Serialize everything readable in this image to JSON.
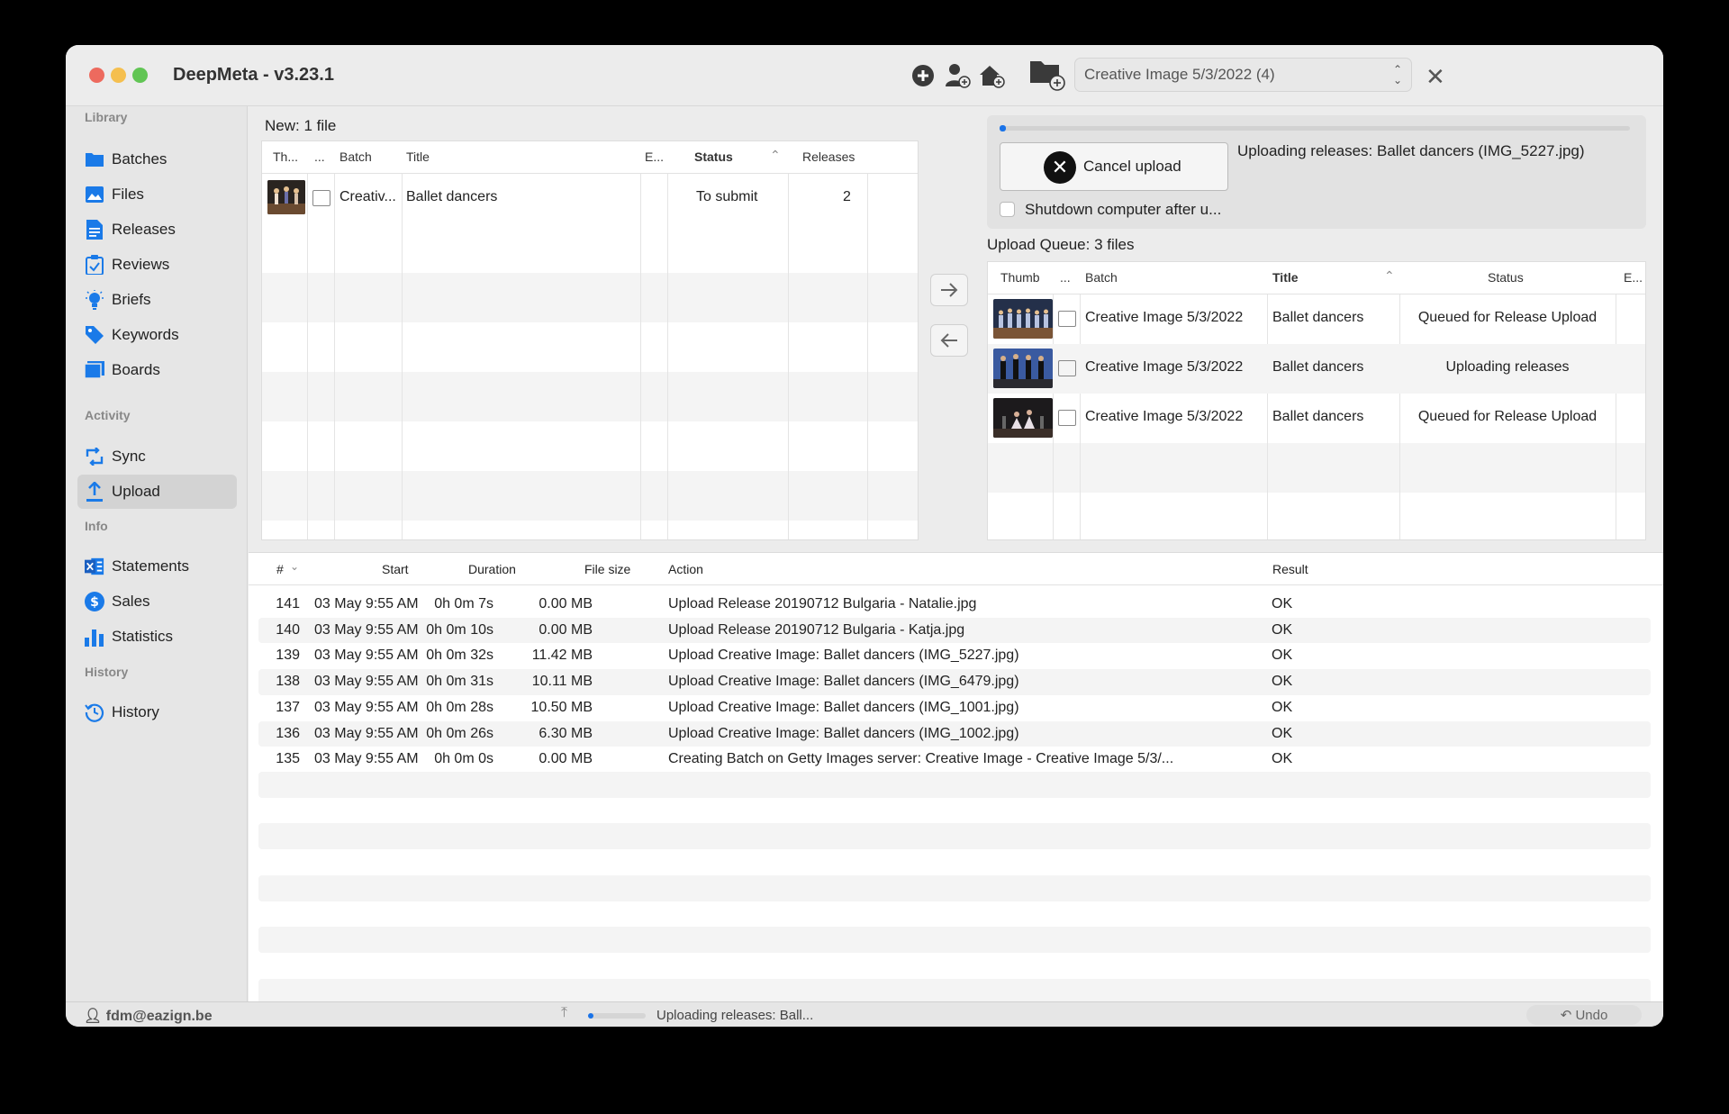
{
  "window": {
    "title": "DeepMeta - v3.23.1",
    "batch_selector": "Creative Image 5/3/2022 (4)"
  },
  "sidebar": {
    "sections": [
      "Library",
      "Activity",
      "Info",
      "History"
    ],
    "library": [
      {
        "label": "Batches",
        "icon": "folder-icon"
      },
      {
        "label": "Files",
        "icon": "image-icon"
      },
      {
        "label": "Releases",
        "icon": "document-icon"
      },
      {
        "label": "Reviews",
        "icon": "clipboard-check-icon"
      },
      {
        "label": "Briefs",
        "icon": "lightbulb-icon"
      },
      {
        "label": "Keywords",
        "icon": "tag-icon"
      },
      {
        "label": "Boards",
        "icon": "board-icon"
      }
    ],
    "activity": [
      {
        "label": "Sync",
        "icon": "sync-icon"
      },
      {
        "label": "Upload",
        "icon": "upload-icon",
        "active": true
      }
    ],
    "info": [
      {
        "label": "Statements",
        "icon": "excel-icon"
      },
      {
        "label": "Sales",
        "icon": "dollar-icon"
      },
      {
        "label": "Statistics",
        "icon": "bar-chart-icon"
      }
    ],
    "history": [
      {
        "label": "History",
        "icon": "history-icon"
      }
    ]
  },
  "new_files": {
    "label": "New: 1 file",
    "headers": [
      "Th...",
      "...",
      "Batch",
      "Title",
      "E...",
      "Status",
      "Releases"
    ],
    "rows": [
      {
        "batch": "Creativ...",
        "title": "Ballet dancers",
        "status": "To submit",
        "releases": "2"
      }
    ]
  },
  "upload": {
    "progress": 0.01,
    "cancel_label": "Cancel upload",
    "status_text": "Uploading releases: Ballet dancers (IMG_5227.jpg)",
    "shutdown_label": "Shutdown computer after u..."
  },
  "queue": {
    "label": "Upload Queue: 3 files",
    "headers": [
      "Thumb",
      "...",
      "Batch",
      "Title",
      "Status",
      "E..."
    ],
    "rows": [
      {
        "batch": "Creative Image 5/3/2022",
        "title": "Ballet dancers",
        "status": "Queued for Release Upload"
      },
      {
        "batch": "Creative Image 5/3/2022",
        "title": "Ballet dancers",
        "status": "Uploading releases"
      },
      {
        "batch": "Creative Image 5/3/2022",
        "title": "Ballet dancers",
        "status": "Queued for Release Upload"
      }
    ]
  },
  "log": {
    "headers": [
      "#",
      "Start",
      "Duration",
      "File size",
      "Action",
      "Result"
    ],
    "rows": [
      {
        "num": "141",
        "start": "03 May 9:55 AM",
        "duration": "0h 0m 7s",
        "size": "0.00 MB",
        "action": "Upload Release 20190712 Bulgaria - Natalie.jpg",
        "result": "OK"
      },
      {
        "num": "140",
        "start": "03 May 9:55 AM",
        "duration": "0h 0m 10s",
        "size": "0.00 MB",
        "action": "Upload Release 20190712 Bulgaria - Katja.jpg",
        "result": "OK"
      },
      {
        "num": "139",
        "start": "03 May 9:55 AM",
        "duration": "0h 0m 32s",
        "size": "11.42 MB",
        "action": "Upload Creative Image: Ballet dancers (IMG_5227.jpg)",
        "result": "OK"
      },
      {
        "num": "138",
        "start": "03 May 9:55 AM",
        "duration": "0h 0m 31s",
        "size": "10.11 MB",
        "action": "Upload Creative Image: Ballet dancers (IMG_6479.jpg)",
        "result": "OK"
      },
      {
        "num": "137",
        "start": "03 May 9:55 AM",
        "duration": "0h 0m 28s",
        "size": "10.50 MB",
        "action": "Upload Creative Image: Ballet dancers (IMG_1001.jpg)",
        "result": "OK"
      },
      {
        "num": "136",
        "start": "03 May 9:55 AM",
        "duration": "0h 0m 26s",
        "size": "6.30 MB",
        "action": "Upload Creative Image: Ballet dancers (IMG_1002.jpg)",
        "result": "OK"
      },
      {
        "num": "135",
        "start": "03 May 9:55 AM",
        "duration": "0h 0m 0s",
        "size": "0.00 MB",
        "action": "Creating Batch on Getty Images server: Creative Image - Creative Image 5/3/...",
        "result": "OK"
      }
    ]
  },
  "statusbar": {
    "user": "fdm@eazign.be",
    "progress": 0.1,
    "text": "Uploading releases: Ball...",
    "undo": "Undo"
  }
}
